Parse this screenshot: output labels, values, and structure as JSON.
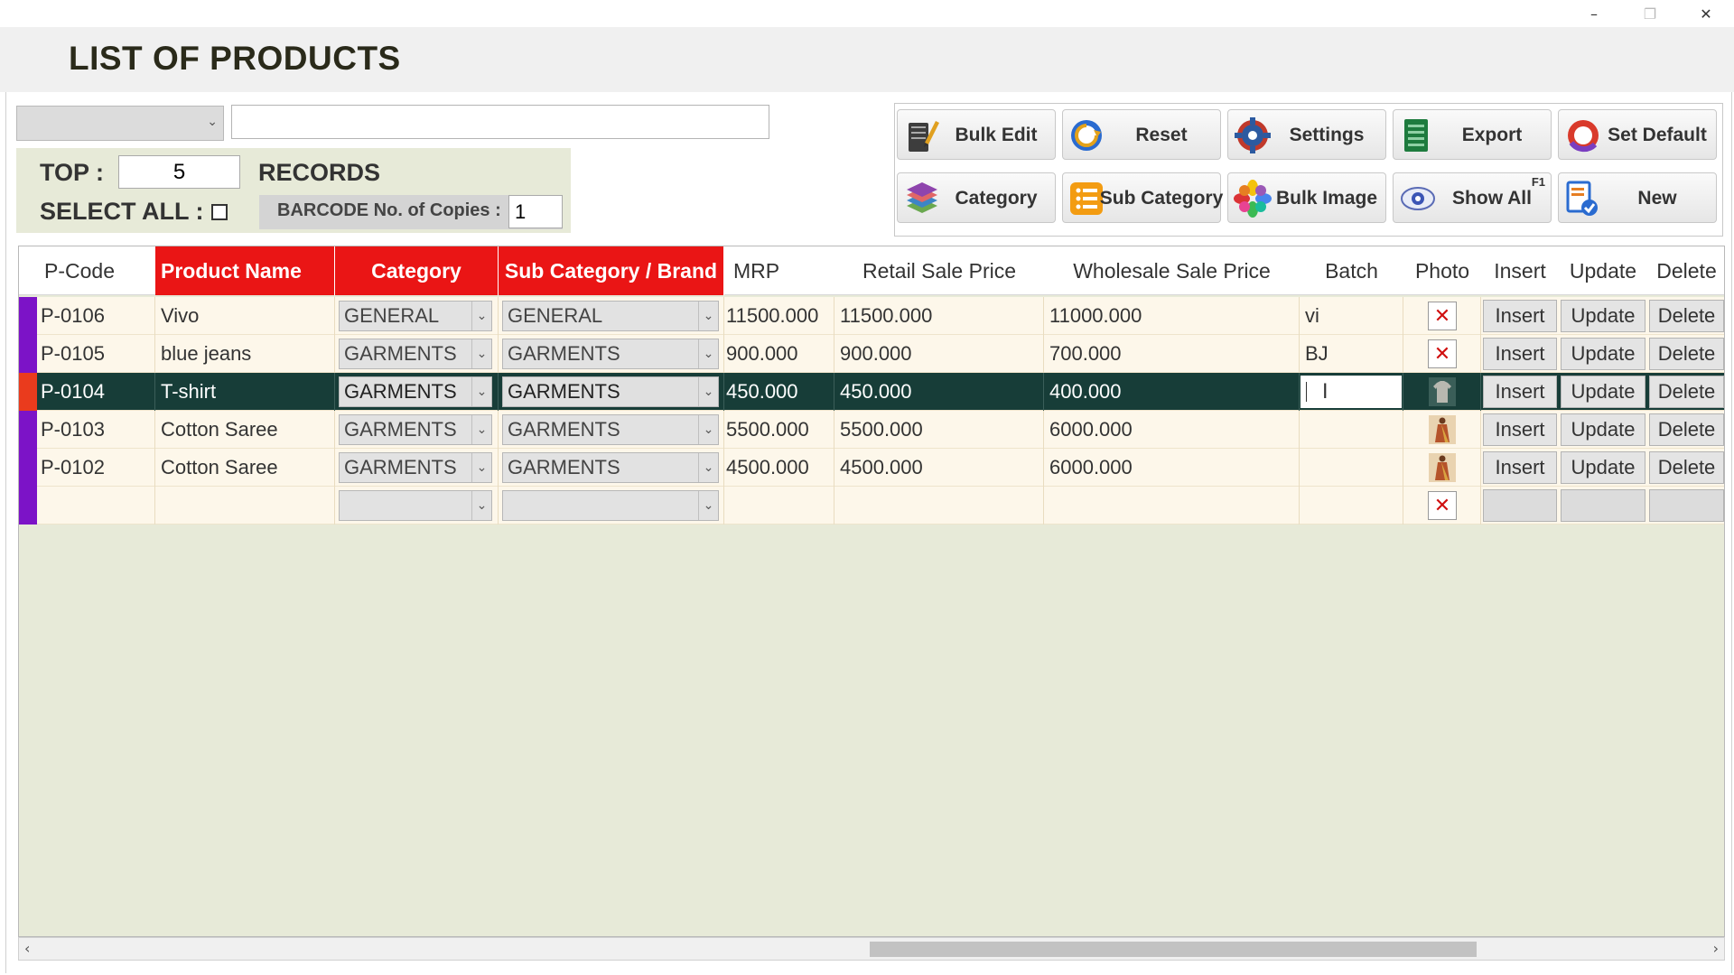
{
  "window": {
    "minimize": "–",
    "maximize": "❐",
    "close": "✕"
  },
  "page_title": "LIST OF PRODUCTS",
  "filter": {
    "combo_value": "",
    "search_value": ""
  },
  "top_panel": {
    "top_label": "TOP :",
    "top_value": "5",
    "records_label": "RECORDS",
    "select_all_label": "SELECT ALL :",
    "barcode_label": "BARCODE No. of Copies :",
    "barcode_value": "1"
  },
  "toolbar": {
    "bulk_edit": "Bulk Edit",
    "reset": "Reset",
    "settings": "Settings",
    "export": "Export",
    "set_default": "Set Default",
    "category": "Category",
    "sub_category": "Sub Category",
    "bulk_image": "Bulk Image",
    "show_all": "Show All",
    "show_all_hotkey": "F1",
    "new": "New"
  },
  "grid": {
    "columns": [
      "P-Code",
      "Product Name",
      "Category",
      "Sub Category / Brand",
      "MRP",
      "Retail Sale Price",
      "Wholesale Sale Price",
      "Batch",
      "Photo",
      "Insert",
      "Update",
      "Delete"
    ],
    "rows": [
      {
        "code": "P-0106",
        "name": "Vivo",
        "category": "GENERAL",
        "subcategory": "GENERAL",
        "mrp": "11500.000",
        "retail": "11500.000",
        "wholesale": "11000.000",
        "batch": "vi",
        "photo": "none",
        "insert": "Insert",
        "update": "Update",
        "delete": "Delete"
      },
      {
        "code": "P-0105",
        "name": "blue jeans",
        "category": "GARMENTS",
        "subcategory": "GARMENTS",
        "mrp": "900.000",
        "retail": "900.000",
        "wholesale": "700.000",
        "batch": "BJ",
        "photo": "none",
        "insert": "Insert",
        "update": "Update",
        "delete": "Delete"
      },
      {
        "code": "P-0104",
        "name": "T-shirt",
        "category": "GARMENTS",
        "subcategory": "GARMENTS",
        "mrp": "450.000",
        "retail": "450.000",
        "wholesale": "400.000",
        "batch": "",
        "photo": "tshirt",
        "insert": "Insert",
        "update": "Update",
        "delete": "Delete"
      },
      {
        "code": "P-0103",
        "name": "Cotton Saree",
        "category": "GARMENTS",
        "subcategory": "GARMENTS",
        "mrp": "5500.000",
        "retail": "5500.000",
        "wholesale": "6000.000",
        "batch": "",
        "photo": "saree",
        "insert": "Insert",
        "update": "Update",
        "delete": "Delete"
      },
      {
        "code": "P-0102",
        "name": "Cotton Saree",
        "category": "GARMENTS",
        "subcategory": "GARMENTS",
        "mrp": "4500.000",
        "retail": "4500.000",
        "wholesale": "6000.000",
        "batch": "",
        "photo": "saree",
        "insert": "Insert",
        "update": "Update",
        "delete": "Delete"
      },
      {
        "code": "",
        "name": "",
        "category": "",
        "subcategory": "",
        "mrp": "",
        "retail": "",
        "wholesale": "",
        "batch": "",
        "photo": "none",
        "insert": "",
        "update": "",
        "delete": ""
      }
    ],
    "selected_row": 2,
    "required_columns": [
      "Product Name",
      "Category",
      "Sub Category / Brand"
    ]
  },
  "colors": {
    "required_header": "#ea1515",
    "row_marker": "#7c13c7",
    "selected_row": "#173d38",
    "selected_marker": "#ea3b1d",
    "grid_background": "#e7ead8"
  }
}
